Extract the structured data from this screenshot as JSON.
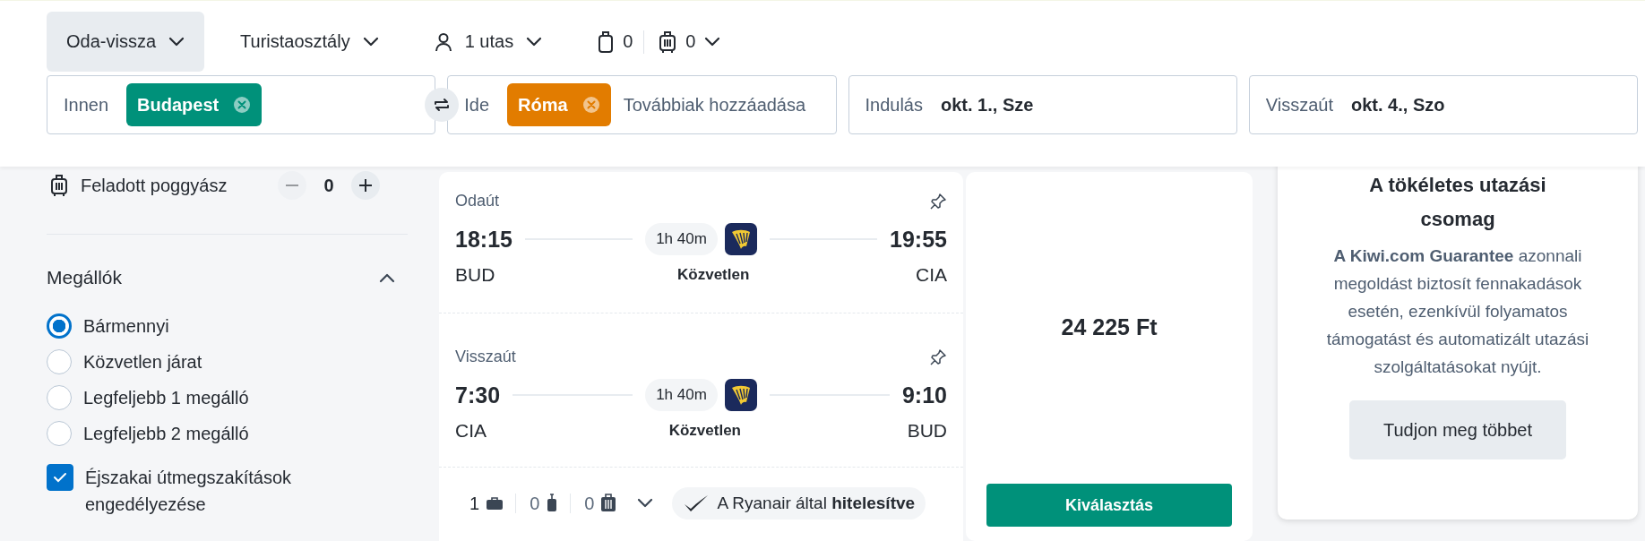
{
  "header": {
    "toolbar": [
      {
        "kind": "dropdown",
        "label": "Oda-vissza",
        "selected": true
      },
      {
        "kind": "dropdown",
        "label": "Turistaosztály",
        "selected": false
      },
      {
        "kind": "passengers",
        "label": "1 utas",
        "selected": false
      },
      {
        "kind": "bags",
        "cabin": "0",
        "checked": "0",
        "selected": false
      }
    ],
    "search_fields": [
      {
        "kind": "place",
        "label": "Innen",
        "chips": [
          {
            "text": "Budapest",
            "color": "#00917a"
          }
        ]
      },
      {
        "kind": "place",
        "label": "Ide",
        "chips": [
          {
            "text": "Róma",
            "color": "#e27c00"
          }
        ],
        "placeholder": "Továbbiak hozzáadása"
      },
      {
        "kind": "date",
        "label": "Indulás",
        "value": "okt. 1., Sze"
      },
      {
        "kind": "date",
        "label": "Visszaút",
        "value": "okt. 4., Szo"
      }
    ]
  },
  "sidebar": {
    "baggage_row": {
      "label": "Feladott poggyász",
      "count": "0",
      "decrease_disabled": true
    },
    "stops": {
      "title": "Megállók",
      "expanded": true,
      "options": [
        {
          "label": "Bármennyi",
          "selected": true
        },
        {
          "label": "Közvetlen járat",
          "selected": false
        },
        {
          "label": "Legfeljebb 1 megálló",
          "selected": false
        },
        {
          "label": "Legfeljebb 2 megálló",
          "selected": false
        }
      ]
    },
    "overnight": {
      "label": "Éjszakai útmegszakítások engedélyezése",
      "checked": true
    }
  },
  "flight": {
    "legs": [
      {
        "title": "Odaút",
        "depart_time": "18:15",
        "arrive_time": "19:55",
        "from": "BUD",
        "to": "CIA",
        "duration": "1h 40m",
        "stops": "Közvetlen"
      },
      {
        "title": "Visszaút",
        "depart_time": "7:30",
        "arrive_time": "9:10",
        "from": "CIA",
        "to": "BUD",
        "duration": "1h 40m",
        "stops": "Közvetlen"
      }
    ],
    "bags": [
      {
        "kind": "personal",
        "count": "1",
        "included": true
      },
      {
        "kind": "cabin",
        "count": "0",
        "included": false
      },
      {
        "kind": "checked",
        "count": "0",
        "included": false
      }
    ],
    "verified": "A Ryanair által **hitelesítve**",
    "price": "24 225 Ft",
    "select_button": "Kiválasztás"
  },
  "promo": {
    "title": "A tökéletes utazási csomag",
    "text": "**A Kiwi.com Guarantee** azonnali megoldást biztosít fennakadások esetén, ezenkívül folyamatos támogatást és automatizált utazási szolgáltatásokat nyújt.",
    "button": "Tudjon meg többet"
  }
}
